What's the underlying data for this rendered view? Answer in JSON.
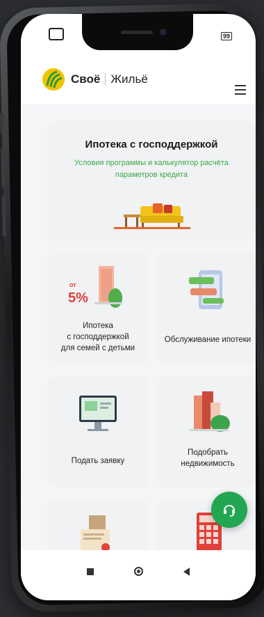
{
  "status_bar": {
    "battery": "99"
  },
  "header": {
    "brand_bold": "Своё",
    "brand_light": "Жильё"
  },
  "hero": {
    "title": "Ипотека с господдержкой",
    "subtitle": "Условия программы и калькулятор расчёта параметров кредита"
  },
  "cards": [
    {
      "label_line1": "Ипотека",
      "label_line2": "с господдержкой",
      "label_line3": "для семей с детьми",
      "badge_small": "от",
      "badge_big": "5%"
    },
    {
      "label": "Обслуживание ипотеки"
    },
    {
      "label": "Подать заявку"
    },
    {
      "label_line1": "Подобрать",
      "label_line2": "недвижимость"
    }
  ],
  "colors": {
    "accent_green": "#22a651",
    "hero_subtitle": "#3aa845",
    "badge_red": "#e0413a"
  }
}
